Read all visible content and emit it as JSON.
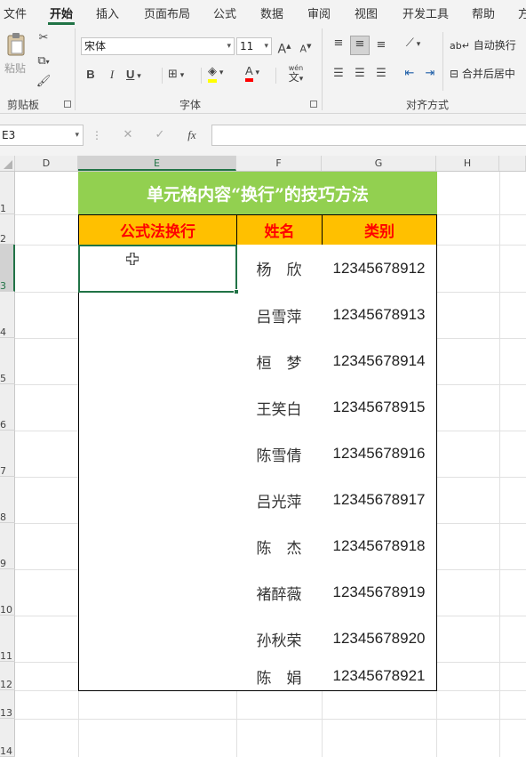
{
  "ribbon": {
    "tabs": [
      {
        "label": "文件",
        "active": false
      },
      {
        "label": "开始",
        "active": true
      },
      {
        "label": "插入",
        "active": false
      },
      {
        "label": "页面布局",
        "active": false
      },
      {
        "label": "公式",
        "active": false
      },
      {
        "label": "数据",
        "active": false
      },
      {
        "label": "审阅",
        "active": false
      },
      {
        "label": "视图",
        "active": false
      },
      {
        "label": "开发工具",
        "active": false
      },
      {
        "label": "帮助",
        "active": false
      },
      {
        "label": "方",
        "active": false
      }
    ],
    "clipboard": {
      "paste_label": "粘贴",
      "group_label": "剪贴板"
    },
    "font": {
      "name": "宋体",
      "size": "11",
      "group_label": "字体",
      "bold": "B",
      "italic": "I",
      "underline": "U",
      "pinyin": "wén"
    },
    "alignment": {
      "wrap_text": "自动换行",
      "merge_center": "合并后居中",
      "group_label": "对齐方式"
    }
  },
  "formula_bar": {
    "name_box": "E3",
    "fx": "fx",
    "formula": ""
  },
  "colors": {
    "accent": "#217346",
    "title_bg": "#92d050",
    "header_bg": "#ffc000",
    "header_text": "#ff0000",
    "title_text": "#ffffff"
  },
  "columns": [
    "D",
    "E",
    "F",
    "G",
    "H"
  ],
  "rows": [
    "1",
    "2",
    "3",
    "4",
    "5",
    "6",
    "7",
    "8",
    "9",
    "10",
    "11",
    "12",
    "13",
    "14"
  ],
  "sheet": {
    "title": "单元格内容“换行”的技巧方法",
    "headers": [
      "公式法换行",
      "姓名",
      "类别"
    ],
    "records": [
      {
        "name": "杨　欣",
        "code": "12345678912"
      },
      {
        "name": "吕雪萍",
        "code": "12345678913"
      },
      {
        "name": "桓　梦",
        "code": "12345678914"
      },
      {
        "name": "王笑白",
        "code": "12345678915"
      },
      {
        "name": "陈雪倩",
        "code": "12345678916"
      },
      {
        "name": "吕光萍",
        "code": "12345678917"
      },
      {
        "name": "陈　杰",
        "code": "12345678918"
      },
      {
        "name": "褚醉薇",
        "code": "12345678919"
      },
      {
        "name": "孙秋荣",
        "code": "12345678920"
      },
      {
        "name": "陈　娟",
        "code": "12345678921"
      }
    ]
  }
}
